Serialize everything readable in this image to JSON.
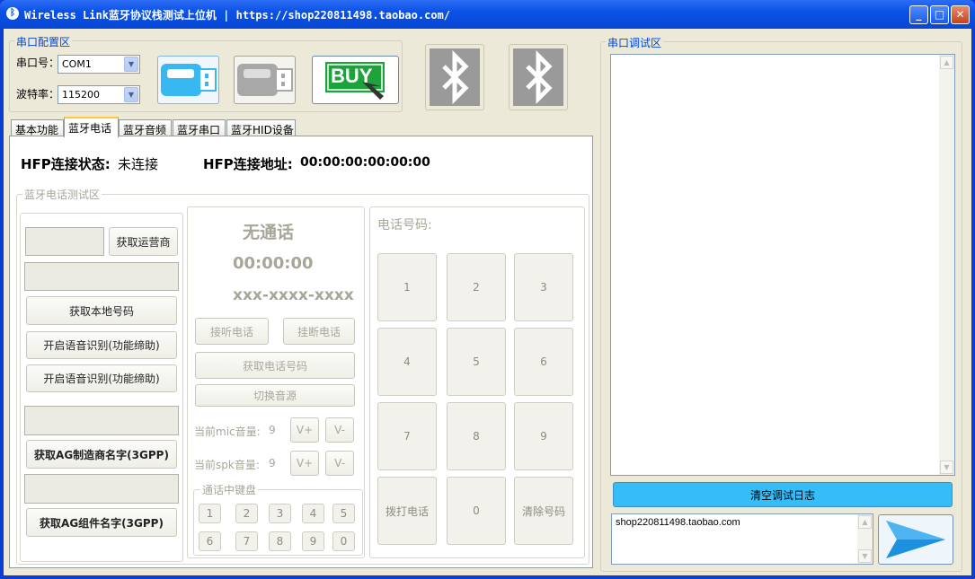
{
  "window": {
    "title": "Wireless Link蓝牙协议栈测试上位机 | https://shop220811498.taobao.com/",
    "minimize": "_",
    "maximize": "□",
    "close": "✕"
  },
  "serial_config": {
    "legend": "串口配置区",
    "port_label": "串口号：",
    "port_value": "COM1",
    "baud_label": "波特率：",
    "baud_value": "115200",
    "buy_text": "BUY"
  },
  "tabs": [
    "基本功能",
    "蓝牙电话",
    "蓝牙音频",
    "蓝牙串口",
    "蓝牙HID设备"
  ],
  "hfp": {
    "status_label": "HFP连接状态:",
    "status_value": "未连接",
    "addr_label": "HFP连接地址:",
    "addr_value": "00:00:00:00:00:00"
  },
  "phone_test": {
    "legend": "蓝牙电话测试区",
    "left": {
      "get_operator": "获取运营商",
      "get_local_number": "获取本地号码",
      "voice_rec_on_1": "开启语音识别(功能缔助)",
      "voice_rec_on_2": "开启语音识别(功能缔助)",
      "get_ag_manufacturer": "获取AG制造商名字(3GPP)",
      "get_ag_model": "获取AG组件名字(3GPP)"
    },
    "mid": {
      "call_status": "无通话",
      "call_time": "00:00:00",
      "call_number": "xxx-xxxx-xxxx",
      "answer": "接听电话",
      "hangup": "挂断电话",
      "get_number": "获取电话号码",
      "switch_audio": "切换音源",
      "mic_label": "当前mic音量:",
      "mic_value": "9",
      "spk_label": "当前spk音量:",
      "spk_value": "9",
      "vol_up": "V+",
      "vol_down": "V-",
      "dtmf_legend": "通话中键盘",
      "dtmf_keys": [
        "1",
        "2",
        "3",
        "4",
        "5",
        "6",
        "7",
        "8",
        "9",
        "0"
      ]
    },
    "right": {
      "phone_number_label": "电话号码:",
      "keys": [
        "1",
        "2",
        "3",
        "4",
        "5",
        "6",
        "7",
        "8",
        "9"
      ],
      "dial": "拨打电话",
      "zero": "0",
      "clear": "清除号码"
    }
  },
  "debug": {
    "legend": "串口调试区",
    "clear_log": "清空调试日志",
    "input_value": "shop220811498.taobao.com",
    "send_icon": "send-arrow-icon"
  },
  "colors": {
    "titlebar": "#0a52e6",
    "clear_button": "#36bdf7",
    "send_button": "#1e90e0",
    "usb_active": "#37b8f0",
    "usb_inactive": "#a8a8a8",
    "bluetooth": "#9a9a9a",
    "buy_green": "#1ea33c"
  }
}
